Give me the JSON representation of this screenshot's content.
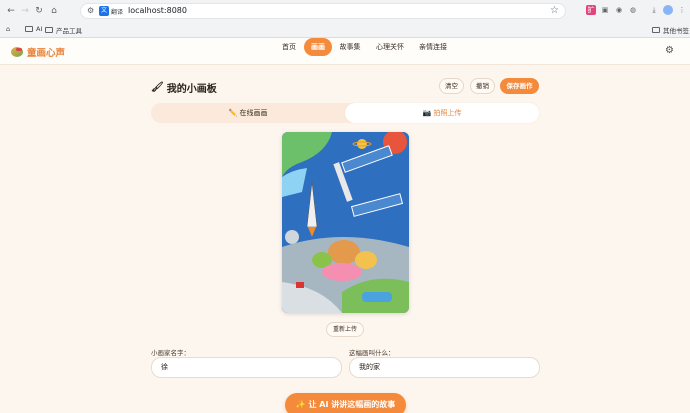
{
  "browser": {
    "url": "localhost:8080",
    "translate_label": "翻译",
    "bookmarks": [
      {
        "label": "AI"
      },
      {
        "label": "产品工具"
      }
    ],
    "other_bookmarks": "其他书签"
  },
  "app": {
    "logo_text": "童画心声",
    "nav": [
      {
        "label": "首页",
        "active": false
      },
      {
        "label": "画画",
        "active": true
      },
      {
        "label": "故事集",
        "active": false
      },
      {
        "label": "心理关怀",
        "active": false
      },
      {
        "label": "亲情连接",
        "active": false
      }
    ]
  },
  "board": {
    "title": "我的小画板",
    "clear_label": "清空",
    "undo_label": "撤销",
    "save_label": "保存画作"
  },
  "tabs": [
    {
      "label": "✏️ 在线画画",
      "active": false
    },
    {
      "label": "📷 拍照上传",
      "active": true
    }
  ],
  "upload": {
    "reupload_label": "重新上传"
  },
  "form": {
    "artist_label": "小画家名字：",
    "artist_value": "徐",
    "artwork_label": "这幅画叫什么：",
    "artwork_value": "我的家"
  },
  "cta_label": "✨ 让 AI 讲讲这幅画的故事",
  "colors": {
    "accent": "#f48a3c",
    "background": "#fdf6ee"
  }
}
